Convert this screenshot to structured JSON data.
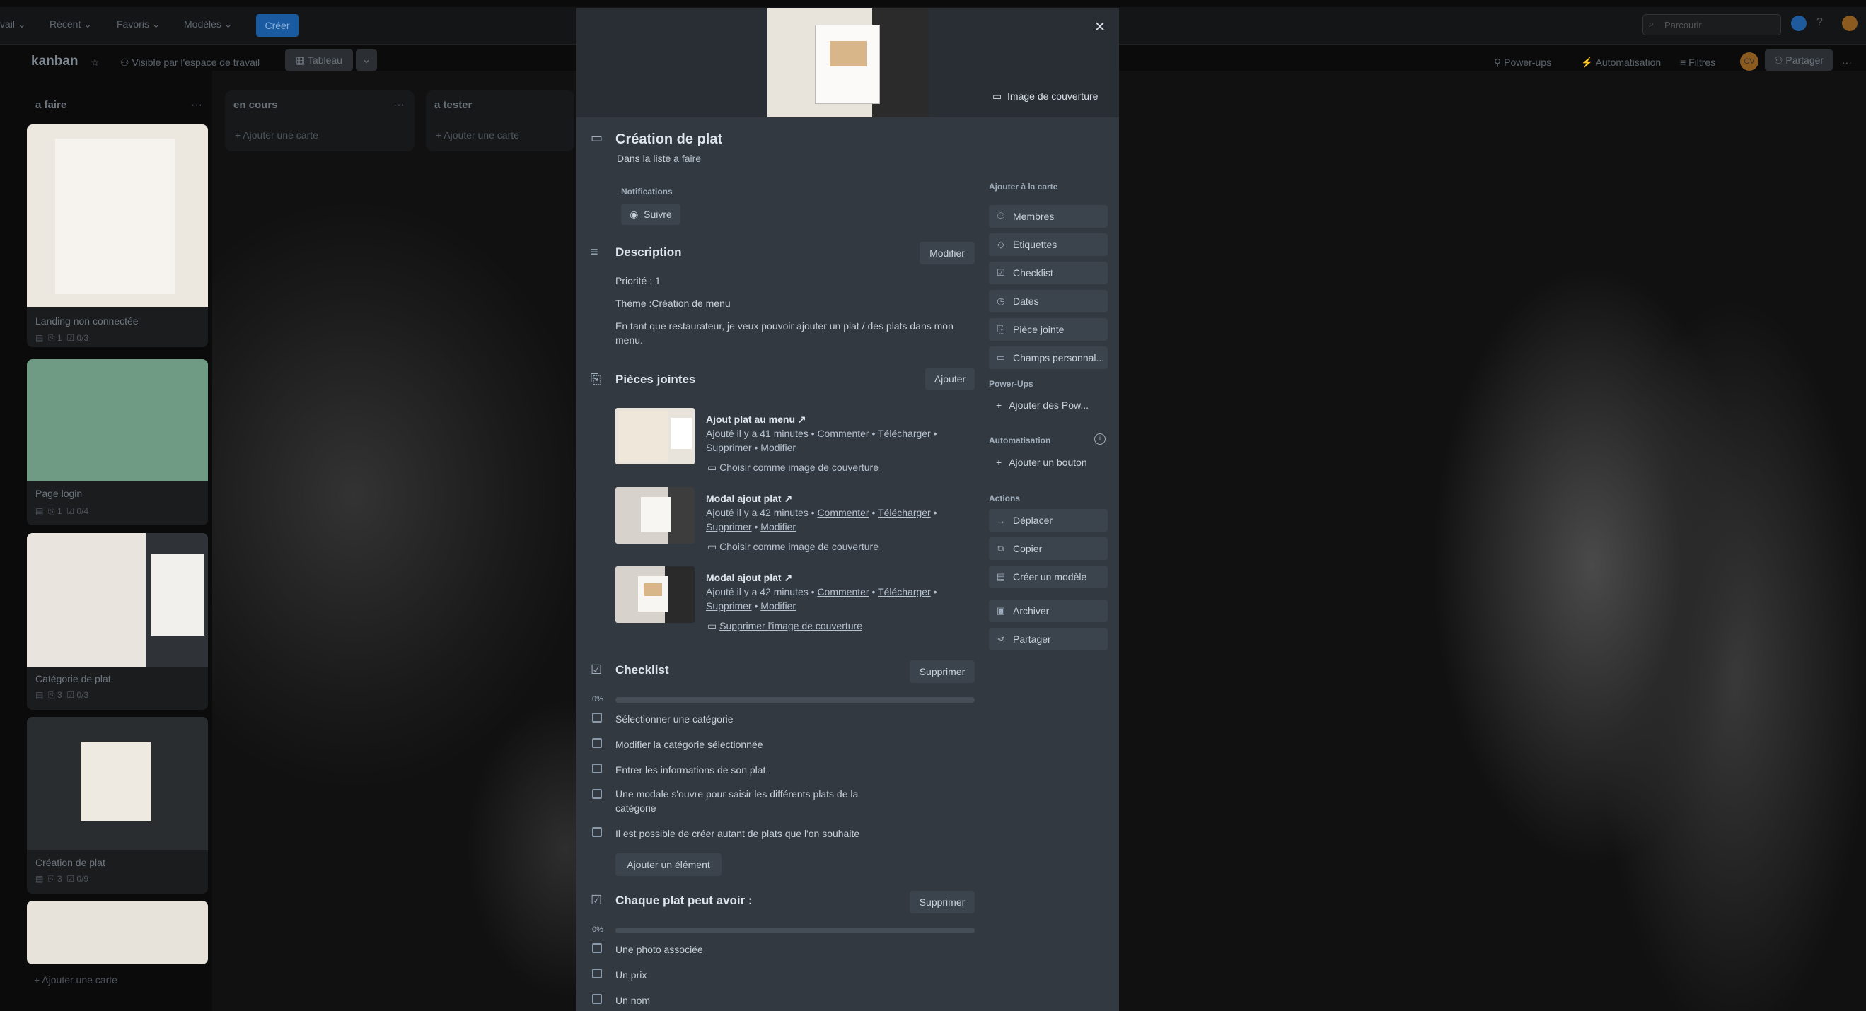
{
  "topnav": {
    "workspace": "vail",
    "recent": "Récent",
    "favorites": "Favoris",
    "templates": "Modèles",
    "create": "Créer",
    "search_placeholder": "Parcourir"
  },
  "board": {
    "title": "kanban",
    "visibility": "Visible par l'espace de travail",
    "view": "Tableau",
    "powerups": "Power-ups",
    "automation": "Automatisation",
    "filters": "Filtres",
    "share": "Partager",
    "avatar": "CV"
  },
  "lists": [
    {
      "title": "a faire",
      "add_card": "Ajouter une carte",
      "cards": [
        {
          "title": "Landing non connectée",
          "attachments": "1",
          "checklist": "0/3"
        },
        {
          "title": "Page login",
          "attachments": "1",
          "checklist": "0/4"
        },
        {
          "title": "Catégorie de plat",
          "attachments": "3",
          "checklist": "0/3"
        },
        {
          "title": "Création de plat",
          "attachments": "3",
          "checklist": "0/9"
        }
      ]
    },
    {
      "title": "en cours",
      "add_card": "Ajouter une carte"
    },
    {
      "title": "a tester",
      "add_card": "Ajouter une carte"
    }
  ],
  "modal": {
    "cover_label": "Image de couverture",
    "title": "Création de plat",
    "in_list_prefix": "Dans la liste",
    "in_list_name": "a faire",
    "notifications_label": "Notifications",
    "follow": "Suivre",
    "description": {
      "heading": "Description",
      "edit": "Modifier",
      "lines": [
        "Priorité : 1",
        "Thème :Création de menu",
        "En tant que restaurateur, je veux pouvoir ajouter un plat / des plats dans mon",
        "menu."
      ]
    },
    "attachments": {
      "heading": "Pièces jointes",
      "add": "Ajouter",
      "items": [
        {
          "name": "Ajout plat au menu",
          "added": "Ajouté il y a 41 minutes",
          "comment": "Commenter",
          "download": "Télécharger",
          "delete": "Supprimer",
          "edit": "Modifier",
          "cover_action": "Choisir comme image de couverture"
        },
        {
          "name": "Modal ajout plat",
          "added": "Ajouté il y a 42 minutes",
          "comment": "Commenter",
          "download": "Télécharger",
          "delete": "Supprimer",
          "edit": "Modifier",
          "cover_action": "Choisir comme image de couverture"
        },
        {
          "name": "Modal ajout plat",
          "added": "Ajouté il y a 42 minutes",
          "comment": "Commenter",
          "download": "Télécharger",
          "delete": "Supprimer",
          "edit": "Modifier",
          "cover_action": "Supprimer l'image de couverture"
        }
      ]
    },
    "checklist1": {
      "heading": "Checklist",
      "delete": "Supprimer",
      "progress": "0%",
      "progress_value": 0,
      "items": [
        "Sélectionner une catégorie",
        "Modifier la catégorie sélectionnée",
        "Entrer les informations de son plat",
        "Une modale s'ouvre pour saisir les différents plats de la",
        "catégorie",
        "Il est possible de créer autant de plats que l'on souhaite"
      ],
      "add_item": "Ajouter un élément"
    },
    "checklist2": {
      "heading": "Chaque plat peut avoir :",
      "delete": "Supprimer",
      "progress": "0%",
      "progress_value": 0,
      "items": [
        "Une photo associée",
        "Un prix",
        "Un nom"
      ]
    },
    "sidebar": {
      "add_to_card": "Ajouter à la carte",
      "members": "Membres",
      "labels": "Étiquettes",
      "checklist": "Checklist",
      "dates": "Dates",
      "attachment": "Pièce jointe",
      "custom_fields": "Champs personnal...",
      "powerups_head": "Power-Ups",
      "add_powerups": "Ajouter des Pow...",
      "automation_head": "Automatisation",
      "add_button": "Ajouter un bouton",
      "actions_head": "Actions",
      "move": "Déplacer",
      "copy": "Copier",
      "template": "Créer un modèle",
      "archive": "Archiver",
      "share": "Partager"
    }
  }
}
